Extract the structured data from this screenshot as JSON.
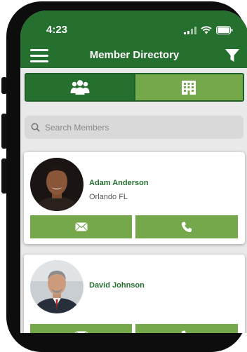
{
  "status_bar": {
    "time": "4:23"
  },
  "header": {
    "title": "Member Directory"
  },
  "segments": [
    {
      "icon": "people-icon",
      "selected": true
    },
    {
      "icon": "building-icon",
      "selected": false
    }
  ],
  "search": {
    "placeholder": "Search Members",
    "value": ""
  },
  "members": [
    {
      "name": "Adam Anderson",
      "location": "Orlando FL"
    },
    {
      "name": "David Johnson",
      "location": ""
    }
  ],
  "colors": {
    "primary": "#26702f",
    "accent": "#74a84a",
    "background": "#e9e9e9"
  }
}
